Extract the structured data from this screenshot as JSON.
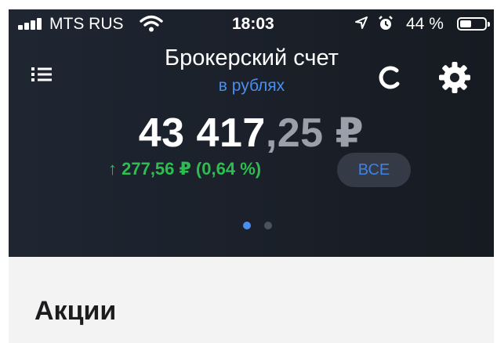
{
  "status_bar": {
    "carrier": "MTS RUS",
    "time": "18:03",
    "battery": "44 %",
    "icons": [
      "signal-icon",
      "wifi-icon",
      "location-icon",
      "alarm-icon",
      "battery-icon"
    ]
  },
  "header": {
    "title": "Брокерский счет",
    "subtitle": "в рублях",
    "balance_integer": "43 417",
    "balance_decimal": ",25 ₽",
    "change": "↑ 277,56 ₽ (0,64 %)",
    "all_button": "ВСЕ",
    "page_indicator": {
      "pages": 2,
      "active": 1
    },
    "icons": [
      "menu-icon",
      "refresh-icon",
      "gear-icon"
    ]
  },
  "colors": {
    "header_bg": "#1c222c",
    "accent_blue": "#4a8ff0",
    "positive_green": "#2dbd50",
    "content_bg": "#f3f3f4"
  },
  "content": {
    "section_title": "Акции"
  }
}
